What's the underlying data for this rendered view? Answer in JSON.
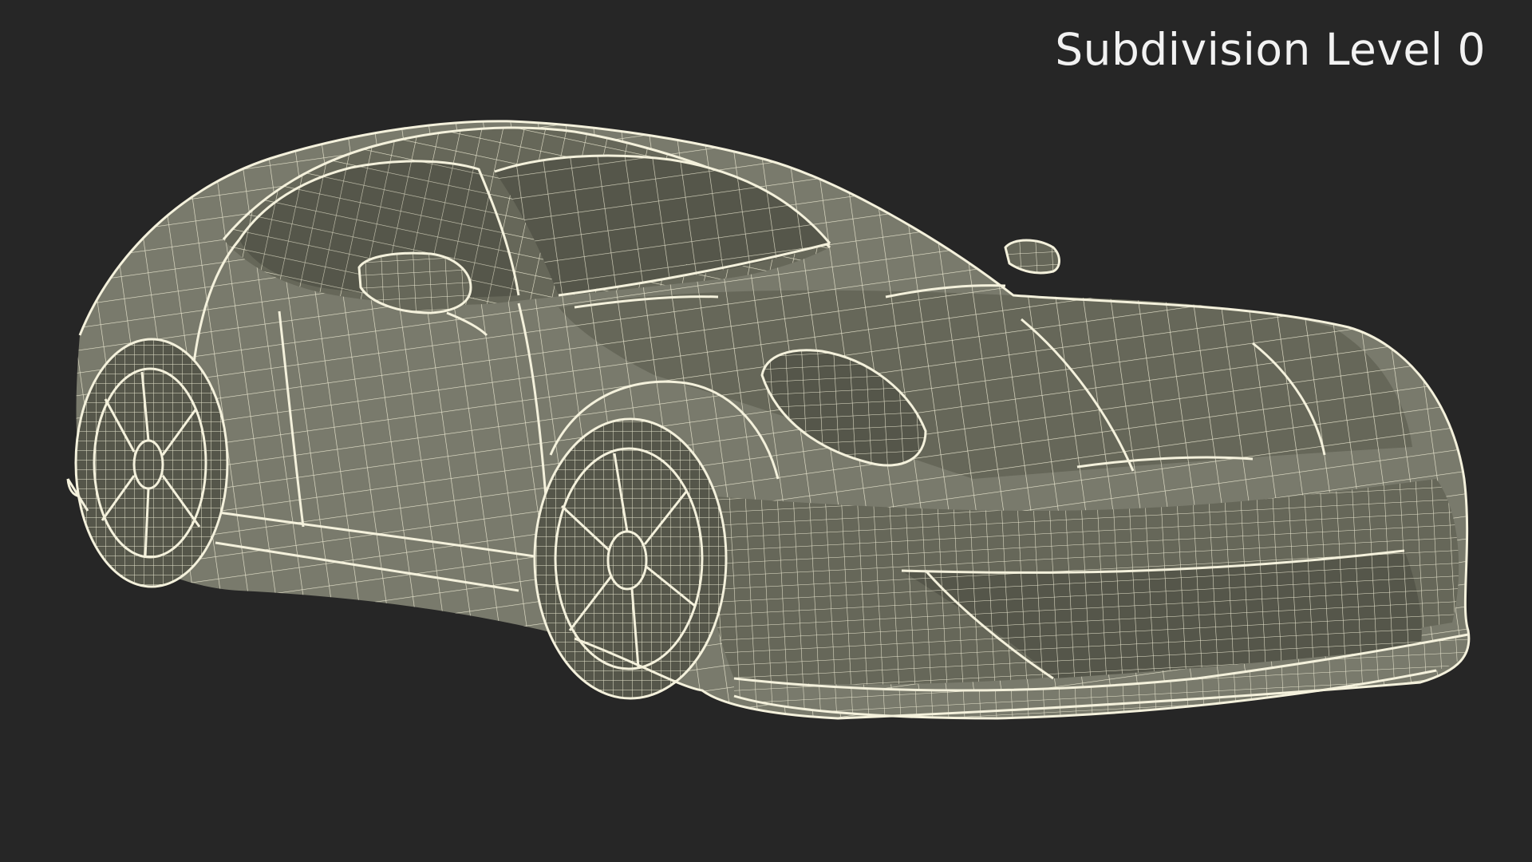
{
  "viewport": {
    "label": "Subdivision Level 0",
    "background_color": "#262626",
    "model_fill_color": "#797a6c",
    "wireframe_color": "#efecd6",
    "render_mode": "wireframe-on-shaded"
  }
}
